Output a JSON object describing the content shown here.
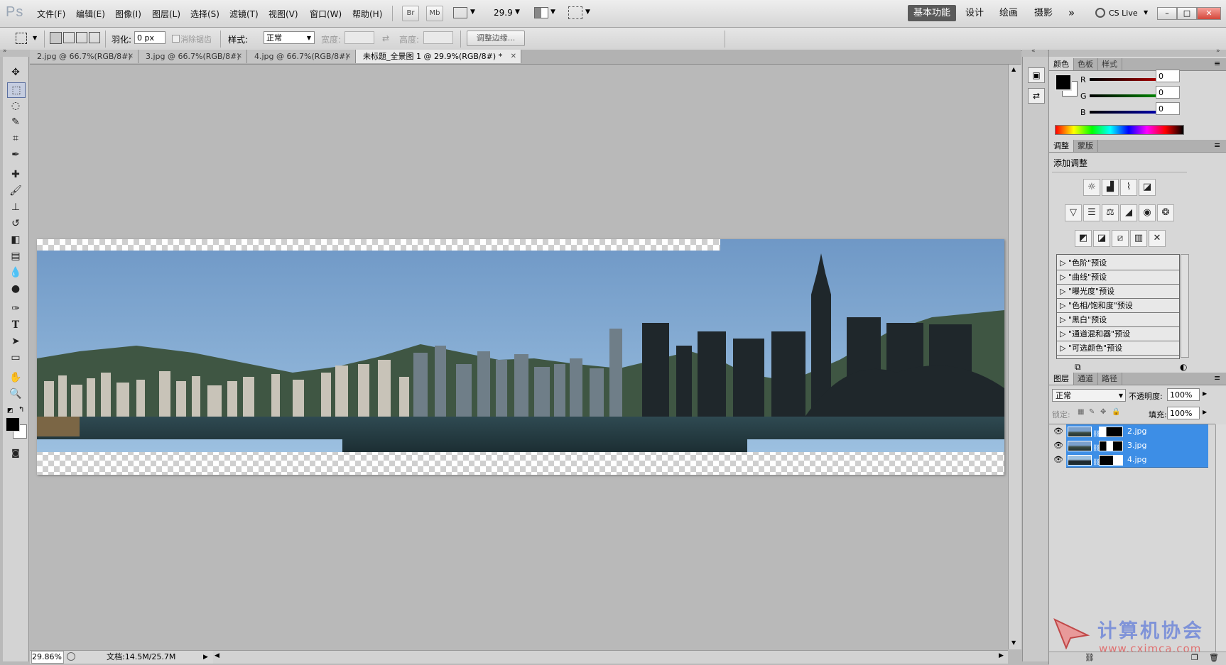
{
  "app": {
    "logo": "Ps"
  },
  "menu": [
    "文件(F)",
    "编辑(E)",
    "图像(I)",
    "图层(L)",
    "选择(S)",
    "滤镜(T)",
    "视图(V)",
    "窗口(W)",
    "帮助(H)"
  ],
  "appbar": {
    "br": "Br",
    "mb": "Mb",
    "zoom": "29.9"
  },
  "workspaces": [
    "基本功能",
    "设计",
    "绘画",
    "摄影"
  ],
  "workspace_more": "»",
  "cslive": "CS Live",
  "window_controls": [
    "–",
    "□",
    "✕"
  ],
  "options": {
    "feather_label": "羽化:",
    "feather_value": "0 px",
    "antialias_label": "消除锯齿",
    "style_label": "样式:",
    "style_value": "正常",
    "width_label": "宽度:",
    "height_label": "高度:",
    "refine_edge": "调整边缘..."
  },
  "tabs": [
    {
      "label": "2.jpg @ 66.7%(RGB/8#)",
      "close": "✕"
    },
    {
      "label": "3.jpg @ 66.7%(RGB/8#)",
      "close": "✕"
    },
    {
      "label": "4.jpg @ 66.7%(RGB/8#)",
      "close": "✕"
    },
    {
      "label": "未标题_全景图 1 @ 29.9%(RGB/8#) *",
      "close": "✕"
    }
  ],
  "status": {
    "zoom": "29.86%",
    "doc": "文档:14.5M/25.7M"
  },
  "color_panel": {
    "tabs": [
      "颜色",
      "色板",
      "样式"
    ],
    "channels": [
      {
        "label": "R",
        "value": "0",
        "color": "#e00000"
      },
      {
        "label": "G",
        "value": "0",
        "color": "#00b000"
      },
      {
        "label": "B",
        "value": "0",
        "color": "#0000e0"
      }
    ]
  },
  "adjust_panel": {
    "tabs": [
      "调整",
      "蒙版"
    ],
    "title": "添加调整",
    "presets": [
      "\"色阶\"预设",
      "\"曲线\"预设",
      "\"曝光度\"预设",
      "\"色相/饱和度\"预设",
      "\"黑白\"预设",
      "\"通道混和器\"预设",
      "\"可选颜色\"预设"
    ]
  },
  "layers_panel": {
    "tabs": [
      "图层",
      "通道",
      "路径"
    ],
    "blend_mode": "正常",
    "opacity_label": "不透明度:",
    "opacity_value": "100%",
    "lock_label": "锁定:",
    "fill_label": "填充:",
    "fill_value": "100%",
    "layers": [
      "2.jpg",
      "3.jpg",
      "4.jpg"
    ]
  },
  "watermark": {
    "title": "计算机协会",
    "url": "www.cxjmca.com"
  }
}
